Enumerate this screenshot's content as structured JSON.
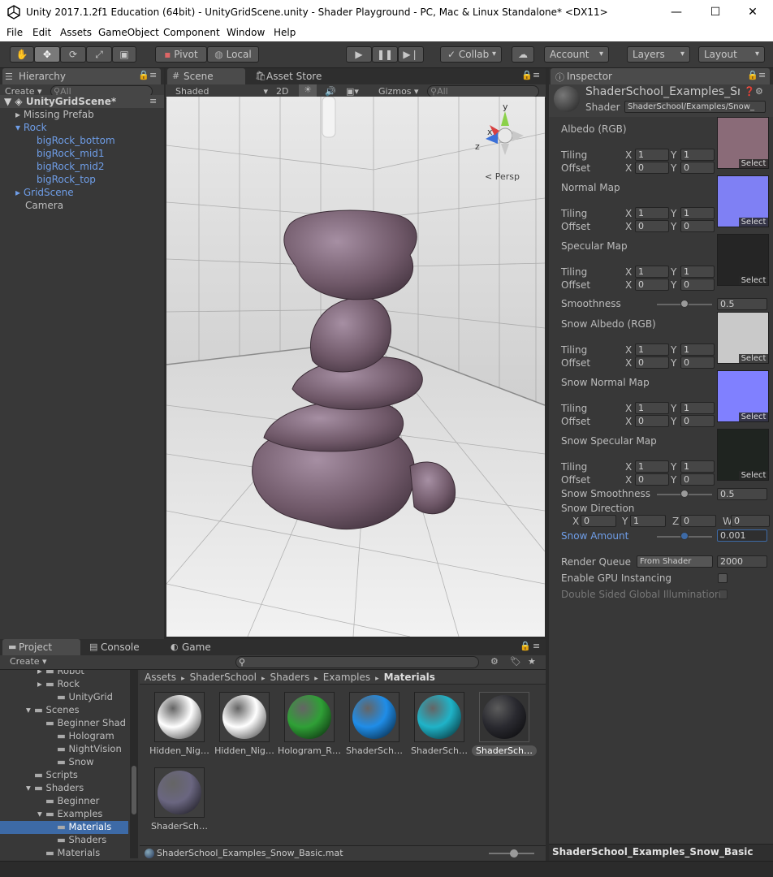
{
  "window": {
    "title": "Unity 2017.1.2f1 Education (64bit) - UnityGridScene.unity - Shader Playground - PC, Mac & Linux Standalone* <DX11>",
    "minimize": "—",
    "maximize": "☐",
    "close": "✕"
  },
  "menu": [
    "File",
    "Edit",
    "Assets",
    "GameObject",
    "Component",
    "Window",
    "Help"
  ],
  "toolbar": {
    "pivot": "Pivot",
    "local": "Local",
    "collab": "Collab",
    "account": "Account",
    "layers": "Layers",
    "layout": "Layout"
  },
  "hierarchy": {
    "tab": "Hierarchy",
    "create": "Create",
    "search_placeholder": "All",
    "scene": "UnityGridScene*",
    "items": [
      "Missing Prefab",
      "Rock",
      "bigRock_bottom",
      "bigRock_mid1",
      "bigRock_mid2",
      "bigRock_top",
      "GridScene",
      "Camera"
    ]
  },
  "scene": {
    "tab": "Scene",
    "asset_tab": "Asset Store",
    "shading": "Shaded",
    "mode2d": "2D",
    "gizmos": "Gizmos",
    "search_placeholder": "All",
    "persp": "Persp",
    "axis_x": "x",
    "axis_y": "y",
    "axis_z": "z"
  },
  "inspector": {
    "tab": "Inspector",
    "material_name": "ShaderSchool_Examples_Sno",
    "shader_label": "Shader",
    "shader_value": "ShaderSchool/Examples/Snow_",
    "select": "Select",
    "tiling": "Tiling",
    "offset": "Offset",
    "x": "X",
    "y": "Y",
    "z": "Z",
    "w": "W",
    "tex_props": [
      {
        "name": "Albedo (RGB)",
        "tx": "1",
        "ty": "1",
        "ox": "0",
        "oy": "0",
        "color": "#8a6b78"
      },
      {
        "name": "Normal Map",
        "tx": "1",
        "ty": "1",
        "ox": "0",
        "oy": "0",
        "color": "#7f80f4"
      },
      {
        "name": "Specular Map",
        "tx": "1",
        "ty": "1",
        "ox": "0",
        "oy": "0",
        "color": "#252525"
      }
    ],
    "smoothness": {
      "label": "Smoothness",
      "value": "0.5",
      "fraction": 0.5
    },
    "snow_props": [
      {
        "name": "Snow Albedo (RGB)",
        "tx": "1",
        "ty": "1",
        "ox": "0",
        "oy": "0",
        "color": "#c9c9c9"
      },
      {
        "name": "Snow Normal Map",
        "tx": "1",
        "ty": "1",
        "ox": "0",
        "oy": "0",
        "color": "#8080ff"
      },
      {
        "name": "Snow Specular Map",
        "tx": "1",
        "ty": "1",
        "ox": "0",
        "oy": "0",
        "color": "#1f2420"
      }
    ],
    "snow_smoothness": {
      "label": "Snow Smoothness",
      "value": "0.5",
      "fraction": 0.5
    },
    "snow_direction": {
      "label": "Snow Direction",
      "x": "0",
      "y": "1",
      "z": "0",
      "w": "0"
    },
    "snow_amount": {
      "label": "Snow Amount",
      "value": "0.001",
      "fraction": 0.5
    },
    "render_queue": {
      "label": "Render Queue",
      "mode": "From Shader",
      "value": "2000"
    },
    "gpu_instancing": "Enable GPU Instancing",
    "double_sided": "Double Sided Global Illumination",
    "footer": "ShaderSchool_Examples_Snow_Basic"
  },
  "project": {
    "tab": "Project",
    "console_tab": "Console",
    "game_tab": "Game",
    "create": "Create",
    "tree": [
      "Robot",
      "Rock",
      "UnityGrid",
      "Scenes",
      "Beginner Shad",
      "Hologram",
      "NightVision",
      "Snow",
      "Scripts",
      "Shaders",
      "Beginner",
      "Examples",
      "Materials",
      "Shaders",
      "Materials"
    ],
    "breadcrumb": [
      "Assets",
      "ShaderSchool",
      "Shaders",
      "Examples",
      "Materials"
    ],
    "assets": [
      {
        "label": "Hidden_Nig…",
        "color": "#ffffff"
      },
      {
        "label": "Hidden_Nig…",
        "color": "#ffffff"
      },
      {
        "label": "Hologram_R…",
        "color": "#2fa036"
      },
      {
        "label": "ShaderSch…",
        "color": "#1f8de8"
      },
      {
        "label": "ShaderSch…",
        "color": "#1fb3c8"
      },
      {
        "label": "ShaderSch…",
        "color": "#2a2a30"
      },
      {
        "label": "ShaderSch…",
        "color": "#6a6680"
      }
    ],
    "status_file": "ShaderSchool_Examples_Snow_Basic.mat"
  },
  "colors": {
    "bg": "#383838",
    "selection": "#3d6aa6",
    "blue_text": "#6f9ee8"
  }
}
